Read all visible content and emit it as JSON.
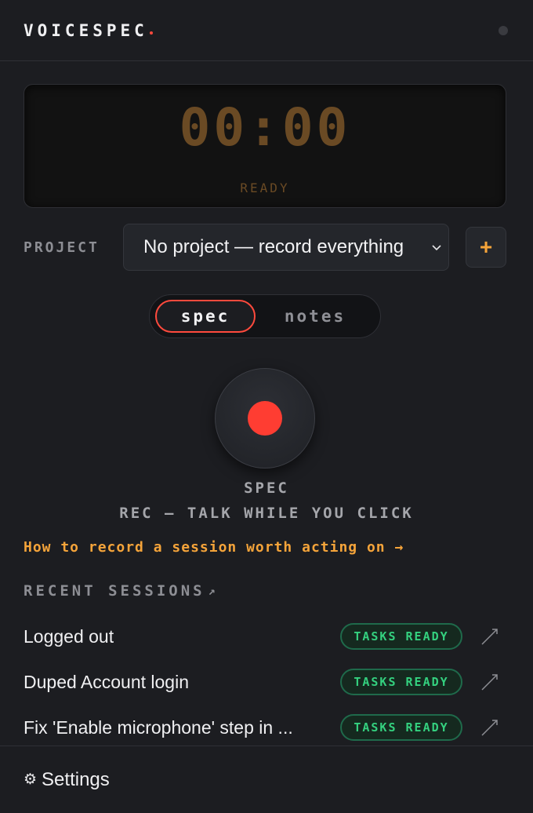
{
  "header": {
    "brand": "VOICESPEC",
    "colors": {
      "brand_dot": "#ff4a3d",
      "status_dot": "#3a3b40"
    }
  },
  "timer": {
    "time": "00:00",
    "status": "READY"
  },
  "project": {
    "label": "PROJECT",
    "selected": "No project — record everything",
    "add_label": "+"
  },
  "mode_toggle": {
    "tabs": [
      {
        "label": "spec",
        "active": true
      },
      {
        "label": "notes",
        "active": false
      }
    ]
  },
  "recorder": {
    "mode_label": "SPEC",
    "hint": "REC — TALK WHILE YOU CLICK",
    "colors": {
      "record": "#ff3d32"
    }
  },
  "guide": {
    "link_text": "How to record a session worth acting on →"
  },
  "recent": {
    "header": "RECENT SESSIONS",
    "header_icon": "↗",
    "sessions": [
      {
        "title": "Logged out",
        "badge": "TASKS READY"
      },
      {
        "title": "Duped Account login",
        "badge": "TASKS READY"
      },
      {
        "title": "Fix 'Enable microphone' step in ...",
        "badge": "TASKS READY"
      }
    ]
  },
  "footer": {
    "settings_icon": "⚙",
    "settings_label": "Settings"
  },
  "colors": {
    "accent": "#f5a43a",
    "badge_text": "#34d17f",
    "background": "#1c1d21"
  }
}
